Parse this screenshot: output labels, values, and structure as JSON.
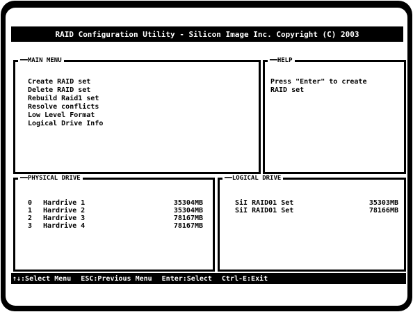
{
  "title": "RAID Configuration Utility - Silicon Image Inc. Copyright (C) 2003",
  "main_menu": {
    "title": "MAIN MENU",
    "items": [
      "Create RAID set",
      "Delete RAID set",
      "Rebuild Raid1 set",
      "Resolve conflicts",
      "Low Level Format",
      "Logical Drive Info"
    ]
  },
  "help": {
    "title": "HELP",
    "text": "Press \"Enter\" to create\nRAID set"
  },
  "physical_drive": {
    "title": "PHYSICAL DRIVE",
    "rows": [
      {
        "index": "0",
        "name": "Hardrive 1",
        "size": "35304MB"
      },
      {
        "index": "1",
        "name": "Hardrive 2",
        "size": "35304MB"
      },
      {
        "index": "2",
        "name": "Hardrive 3",
        "size": "78167MB"
      },
      {
        "index": "3",
        "name": "Hardrive 4",
        "size": "78167MB"
      }
    ]
  },
  "logical_drive": {
    "title": "LOGICAL DRIVE",
    "rows": [
      {
        "name": "SiI RAID01 Set",
        "size": "35303MB"
      },
      {
        "name": "SiI RAID01 Set",
        "size": "78166MB"
      }
    ]
  },
  "status_bar": {
    "hints": [
      "↑↓:Select Menu",
      "ESC:Previous Menu",
      "Enter:Select",
      "Ctrl-E:Exit"
    ]
  },
  "colors": {
    "background": "#ffffff",
    "foreground": "#000000"
  }
}
